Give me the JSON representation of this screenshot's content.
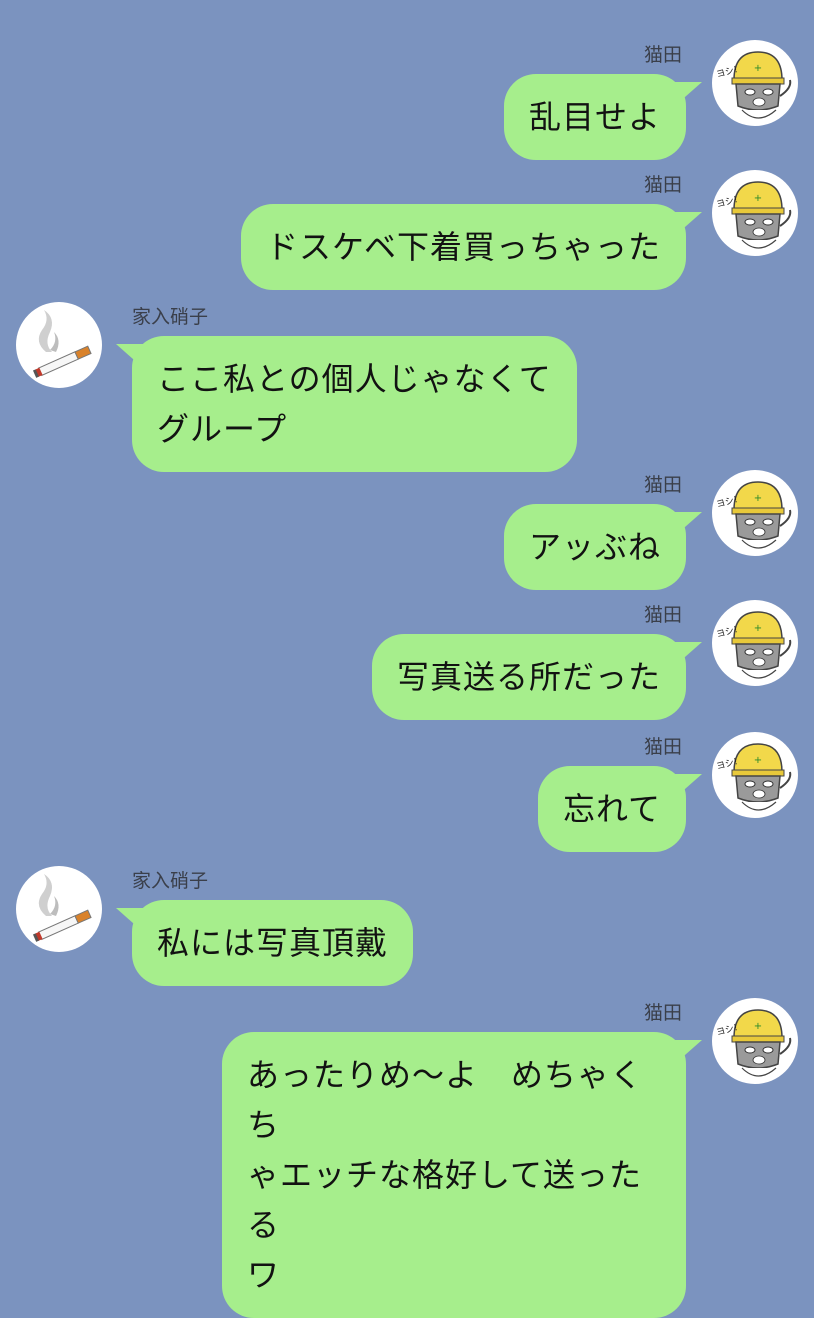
{
  "messages": [
    {
      "side": "right",
      "sender": "猫田",
      "text": "乱目せよ",
      "avatar_icon": "cat-hardhat-icon"
    },
    {
      "side": "right",
      "sender": "猫田",
      "text": "ドスケベ下着買っちゃった",
      "avatar_icon": "cat-hardhat-icon"
    },
    {
      "side": "left",
      "sender": "家入硝子",
      "text": "ここ私との個人じゃなくて\nグループ",
      "avatar_icon": "cigarette-icon"
    },
    {
      "side": "right",
      "sender": "猫田",
      "text": "アッぶね",
      "avatar_icon": "cat-hardhat-icon"
    },
    {
      "side": "right",
      "sender": "猫田",
      "text": "写真送る所だった",
      "avatar_icon": "cat-hardhat-icon"
    },
    {
      "side": "right",
      "sender": "猫田",
      "text": "忘れて",
      "avatar_icon": "cat-hardhat-icon"
    },
    {
      "side": "left",
      "sender": "家入硝子",
      "text": "私には写真頂戴",
      "avatar_icon": "cigarette-icon"
    },
    {
      "side": "right",
      "sender": "猫田",
      "text": "あったりめ〜よ　めちゃくち\nゃエッチな格好して送ったる\nワ",
      "avatar_icon": "cat-hardhat-icon"
    }
  ],
  "cat_sticker_text": "ヨシ!",
  "colors": {
    "background": "#7b93bf",
    "bubble": "#a6ee8c",
    "text": "#121212",
    "name": "#3a3f4a"
  }
}
